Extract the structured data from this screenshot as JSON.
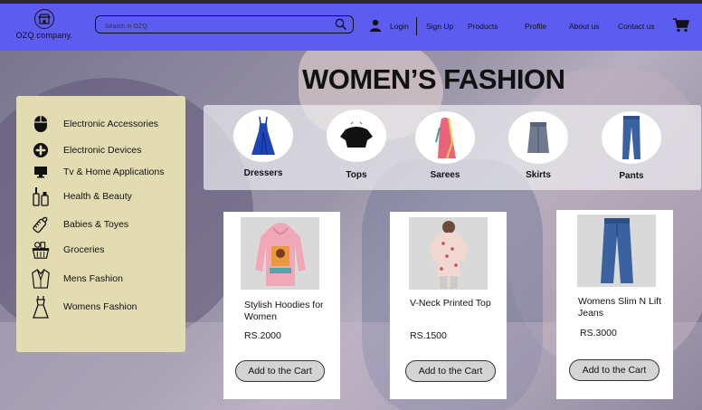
{
  "brand": {
    "name": "OZQ company."
  },
  "search": {
    "placeholder": "Search in OZQ"
  },
  "nav": {
    "login": "Login",
    "signup": "Sign Up",
    "products": "Products",
    "profile": "Profile",
    "about": "About us",
    "contact": "Contact us"
  },
  "hero": {
    "title": "WOMEN’S FASHION"
  },
  "sidebar": {
    "items": [
      {
        "label": "Electronic Accessories",
        "icon": "mouse-icon"
      },
      {
        "label": "Electronic Devices",
        "icon": "fan-icon"
      },
      {
        "label": "Tv & Home Applications",
        "icon": "tv-icon"
      },
      {
        "label": "Health & Beauty",
        "icon": "beauty-products-icon"
      },
      {
        "label": "Babies & Toyes",
        "icon": "baby-bottle-icon"
      },
      {
        "label": "Groceries",
        "icon": "grocery-basket-icon"
      },
      {
        "label": "Mens Fashion",
        "icon": "suit-icon"
      },
      {
        "label": "Womens Fashion",
        "icon": "dress-icon"
      }
    ]
  },
  "categories": [
    {
      "label": "Dressers"
    },
    {
      "label": "Tops"
    },
    {
      "label": "Sarees"
    },
    {
      "label": "Skirts"
    },
    {
      "label": "Pants"
    }
  ],
  "products": [
    {
      "name": "Stylish Hoodies for Women",
      "price": "RS.2000",
      "button": "Add to the Cart"
    },
    {
      "name": "V-Neck Printed Top",
      "price": "RS.1500",
      "button": "Add to the Cart"
    },
    {
      "name": "Womens Slim N Lift Jeans",
      "price": "RS.3000",
      "button": "Add to the Cart"
    }
  ],
  "colors": {
    "navbar": "#5d5cf0",
    "sidebar": "#e3dcb3",
    "button": "#d4d4d4"
  }
}
